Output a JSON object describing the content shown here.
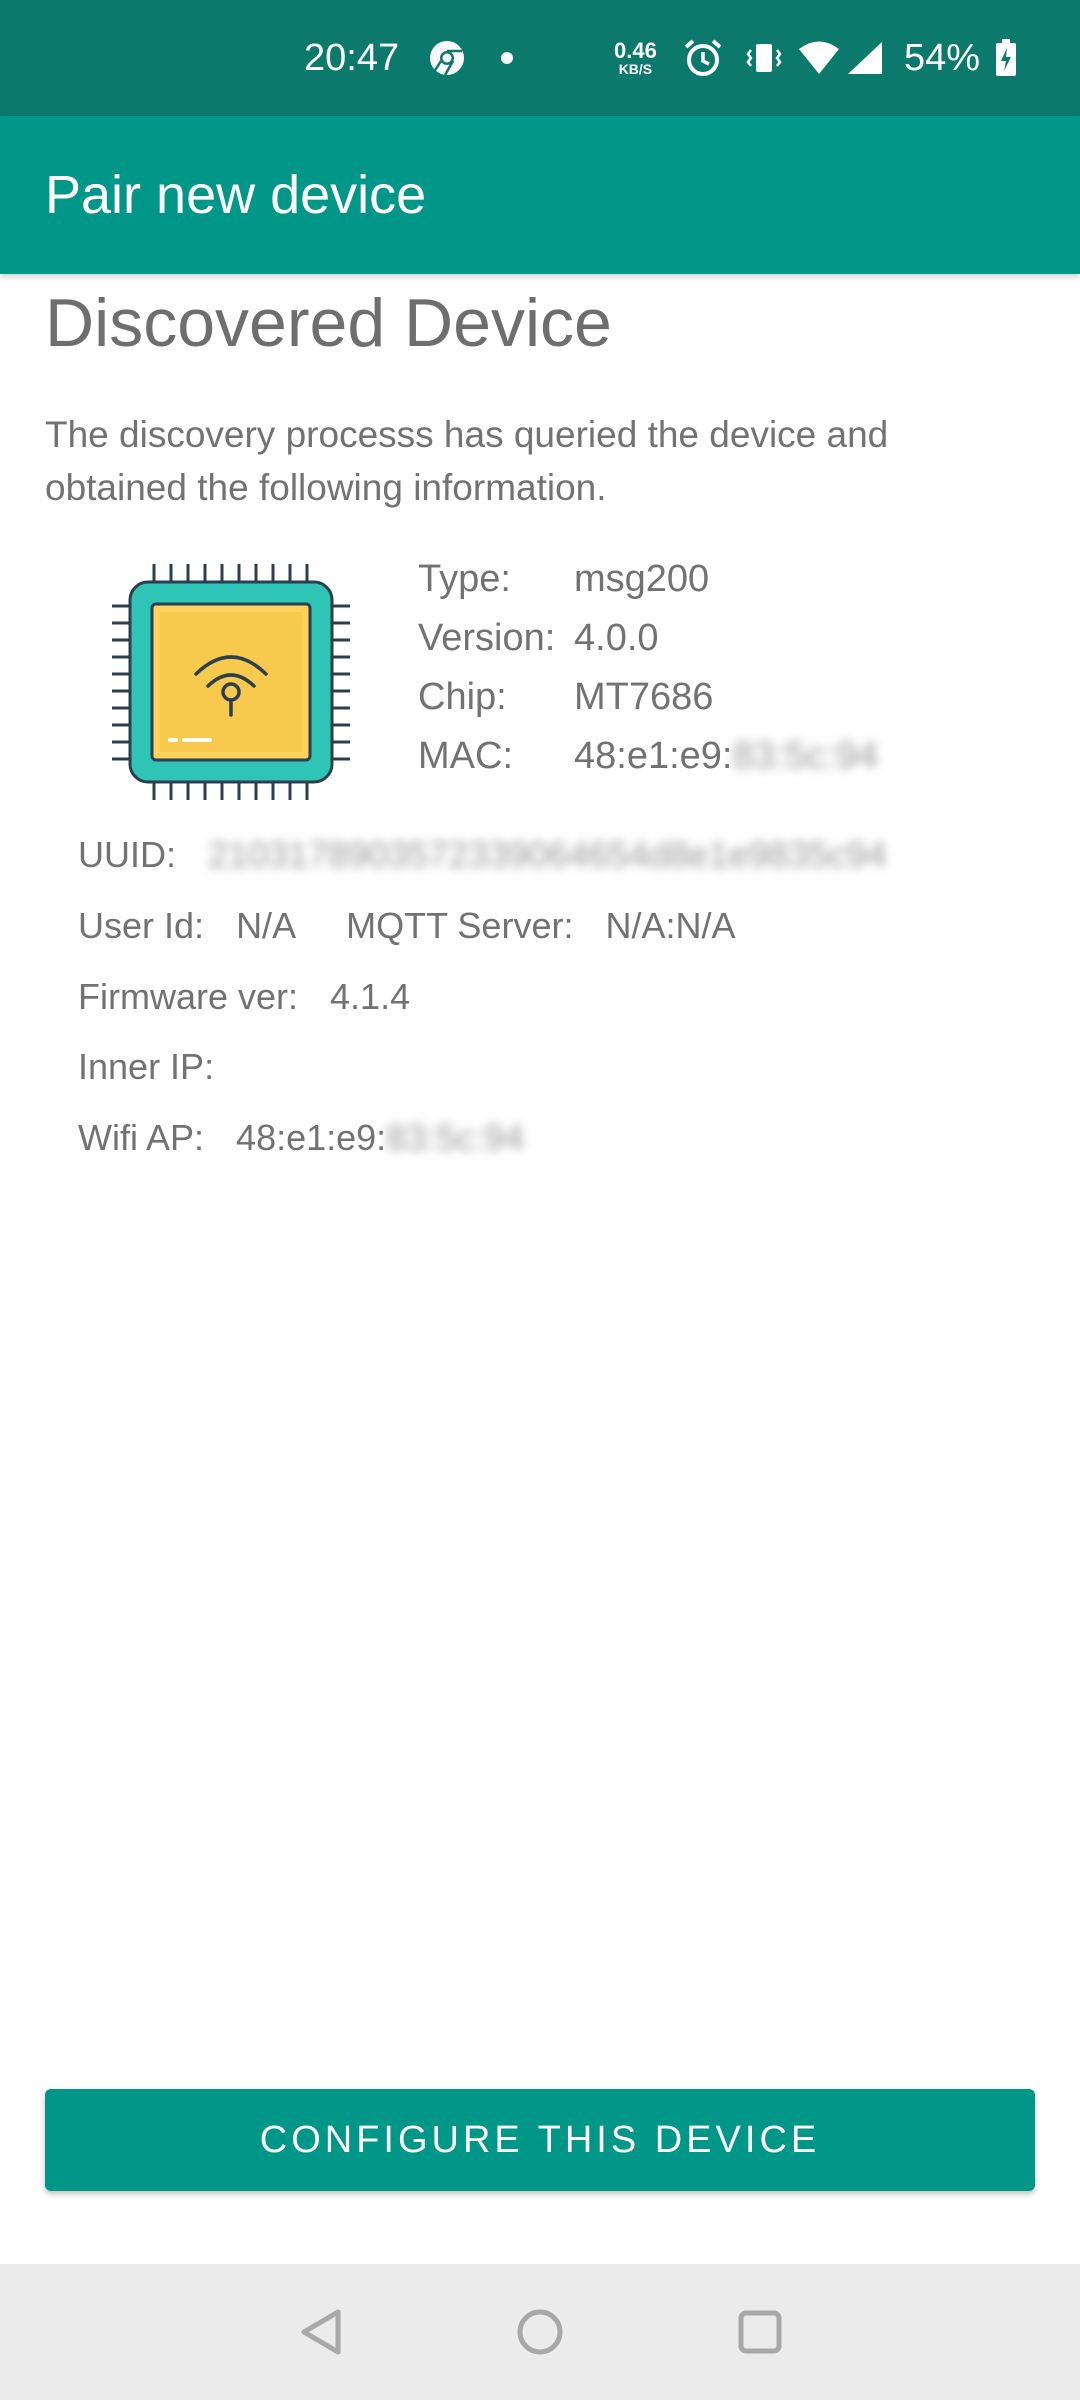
{
  "status_bar": {
    "time": "20:47",
    "net_speed_value": "0.46",
    "net_speed_unit": "KB/S",
    "battery": "54%",
    "icons": [
      "chrome-icon",
      "dot-icon",
      "alarm-icon",
      "vibrate-icon",
      "wifi-icon",
      "signal-icon",
      "battery-charging-icon"
    ]
  },
  "app_bar": {
    "title": "Pair new device"
  },
  "content": {
    "heading": "Discovered Device",
    "description": "The discovery processs has queried the device and obtained the following information.",
    "device_icon": "chip-wifi-icon",
    "type_label": "Type:",
    "type_value": "msg200",
    "version_label": "Version:",
    "version_value": "4.0.0",
    "chip_label": "Chip:",
    "chip_value": "MT7686",
    "mac_label": "MAC:",
    "mac_value": "48:e1:e9:",
    "mac_redacted": "83:5c:94",
    "uuid_label": "UUID:",
    "uuid_redacted": "2103178903572339064654d8e1e9835c94",
    "user_id_label": "User Id:",
    "user_id_value": "N/A",
    "mqtt_label": "MQTT Server:",
    "mqtt_value": "N/A:N/A",
    "firmware_label": "Firmware ver:",
    "firmware_value": "4.1.4",
    "inner_ip_label": "Inner IP:",
    "inner_ip_value": "",
    "wifi_ap_label": "Wifi AP:",
    "wifi_ap_value": "48:e1:e9:",
    "wifi_ap_redacted": "83:5c:94"
  },
  "actions": {
    "configure_label": "CONFIGURE THIS DEVICE"
  },
  "nav_bar": {
    "icons": [
      "back-icon",
      "home-icon",
      "recents-icon"
    ]
  },
  "colors": {
    "status_bar": "#0b7a6d",
    "primary": "#009688",
    "chip_body": "#2ec4b6",
    "chip_core": "#fdd35c",
    "nav_bar": "#ebebeb"
  }
}
